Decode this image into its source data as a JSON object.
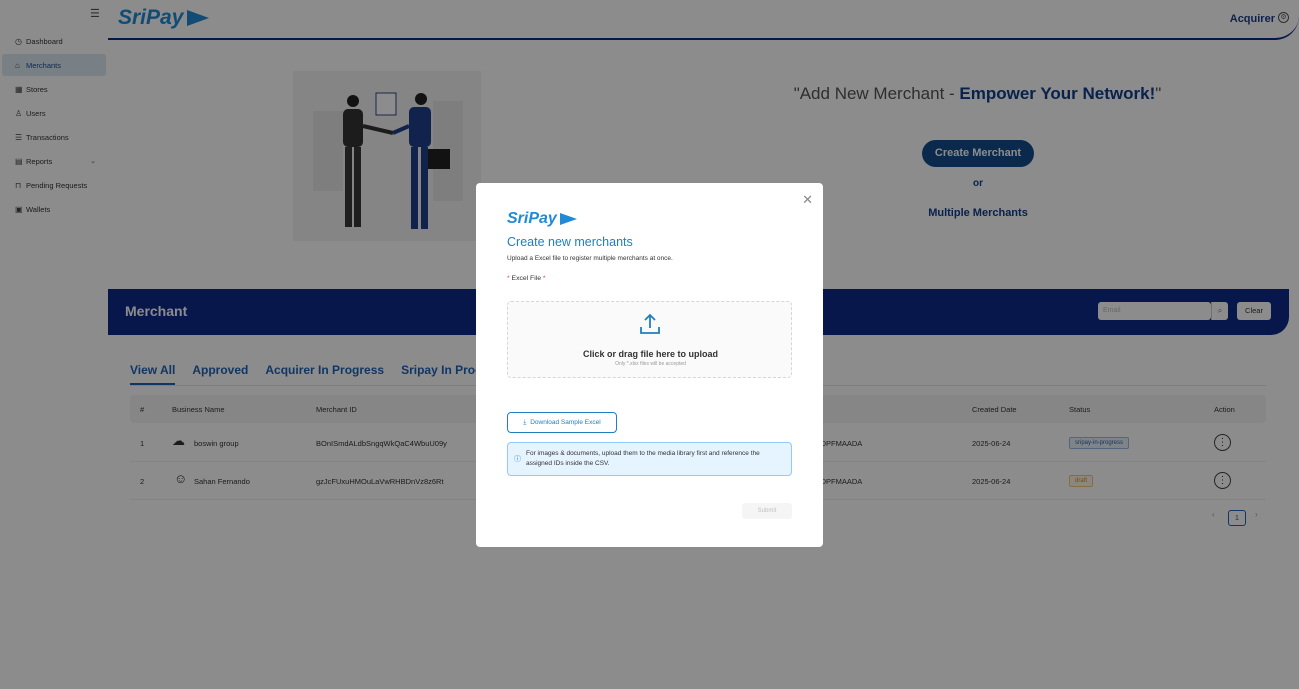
{
  "app": {
    "logo_text": "SriPay"
  },
  "sidebar": {
    "items": [
      {
        "label": "Dashboard",
        "icon": "dashboard-icon",
        "glyph": "◷"
      },
      {
        "label": "Merchants",
        "icon": "home-icon",
        "glyph": "⌂"
      },
      {
        "label": "Stores",
        "icon": "store-icon",
        "glyph": "▦"
      },
      {
        "label": "Users",
        "icon": "user-icon",
        "glyph": "♙"
      },
      {
        "label": "Transactions",
        "icon": "list-icon",
        "glyph": "☰"
      },
      {
        "label": "Reports",
        "icon": "report-icon",
        "glyph": "▤"
      },
      {
        "label": "Pending Requests",
        "icon": "pending-icon",
        "glyph": "⊓"
      },
      {
        "label": "Wallets",
        "icon": "wallet-icon",
        "glyph": "▣"
      }
    ]
  },
  "header": {
    "user_role": "Acquirer"
  },
  "hero": {
    "title_normal": "\"Add New Merchant - ",
    "title_bold": "Empower Your Network!",
    "title_end": "\"",
    "create_button": "Create Merchant",
    "or_text": "or",
    "multiple_link": "Multiple Merchants"
  },
  "merchant_bar": {
    "title": "Merchant",
    "email_placeholder": "Email",
    "clear_label": "Clear"
  },
  "tabs": [
    "View All",
    "Approved",
    "Acquirer In Progress",
    "Sripay In Progre"
  ],
  "table": {
    "columns": {
      "num": "#",
      "business": "Business Name",
      "merchant_id": "Merchant ID",
      "created": "Created Date",
      "status": "Status",
      "action": "Action"
    },
    "rows": [
      {
        "num": "1",
        "business": "boswin group",
        "merchant_id": "BOnISmdALdbSngqWkQaC4WbuU09y",
        "partial": "TDPFMAADA",
        "created": "2025-06-24",
        "status": "sripay-in-progress"
      },
      {
        "num": "2",
        "business": "Sahan Fernando",
        "merchant_id": "gzJcFUxuHMOuLaVwRHBDnVz8z6Rt",
        "partial": "TDPFMAADA",
        "created": "2025-06-24",
        "status": "draft"
      }
    ],
    "page": "1"
  },
  "modal": {
    "logo_text": "SriPay",
    "title": "Create new merchants",
    "subtitle": "Upload a Excel file to register multiple merchants at once.",
    "field_label": "Excel File",
    "req_marker": "*",
    "drop_text": "Click or drag file here to upload",
    "drop_hint": "Only *.xlsx files will be accepted",
    "download_label": "Download Sample Excel",
    "info_text": "For images & documents, upload them to the media library first and reference the assigned IDs inside the CSV.",
    "submit_label": "Submit"
  },
  "colors": {
    "primary_navy": "#0d2a8a",
    "brand_blue": "#1f8ad6",
    "accent_teal": "#134c8c"
  }
}
